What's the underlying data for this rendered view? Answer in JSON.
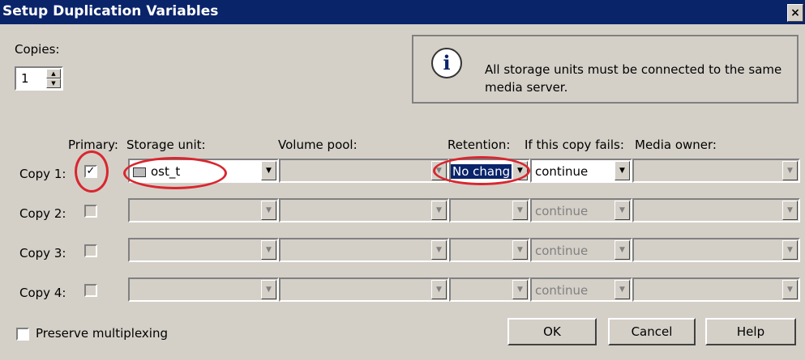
{
  "window": {
    "title": "Setup Duplication Variables",
    "close_symbol": "×"
  },
  "copies": {
    "label": "Copies:",
    "value": "1"
  },
  "info": {
    "icon": "info-icon",
    "message": "All storage units must be connected to the same media server."
  },
  "headers": {
    "primary": "Primary:",
    "storage_unit": "Storage unit:",
    "volume_pool": "Volume pool:",
    "retention": "Retention:",
    "if_fails": "If this copy fails:",
    "media_owner": "Media owner:"
  },
  "rows": [
    {
      "label": "Copy 1:",
      "primary": true,
      "storage_unit": "ost_t",
      "volume_pool": "",
      "retention": "No chang",
      "if_fails": "continue",
      "media_owner": "",
      "enabled": true
    },
    {
      "label": "Copy 2:",
      "primary": false,
      "storage_unit": "",
      "volume_pool": "",
      "retention": "",
      "if_fails": "continue",
      "media_owner": "",
      "enabled": false
    },
    {
      "label": "Copy 3:",
      "primary": false,
      "storage_unit": "",
      "volume_pool": "",
      "retention": "",
      "if_fails": "continue",
      "media_owner": "",
      "enabled": false
    },
    {
      "label": "Copy 4:",
      "primary": false,
      "storage_unit": "",
      "volume_pool": "",
      "retention": "",
      "if_fails": "continue",
      "media_owner": "",
      "enabled": false
    }
  ],
  "preserve_multiplexing": {
    "label": "Preserve multiplexing",
    "checked": false
  },
  "buttons": {
    "ok": "OK",
    "cancel": "Cancel",
    "help": "Help"
  },
  "colors": {
    "titlebar": "#0a246a",
    "dialog_bg": "#d4d0c8",
    "annotation_ring": "#d9262f"
  }
}
